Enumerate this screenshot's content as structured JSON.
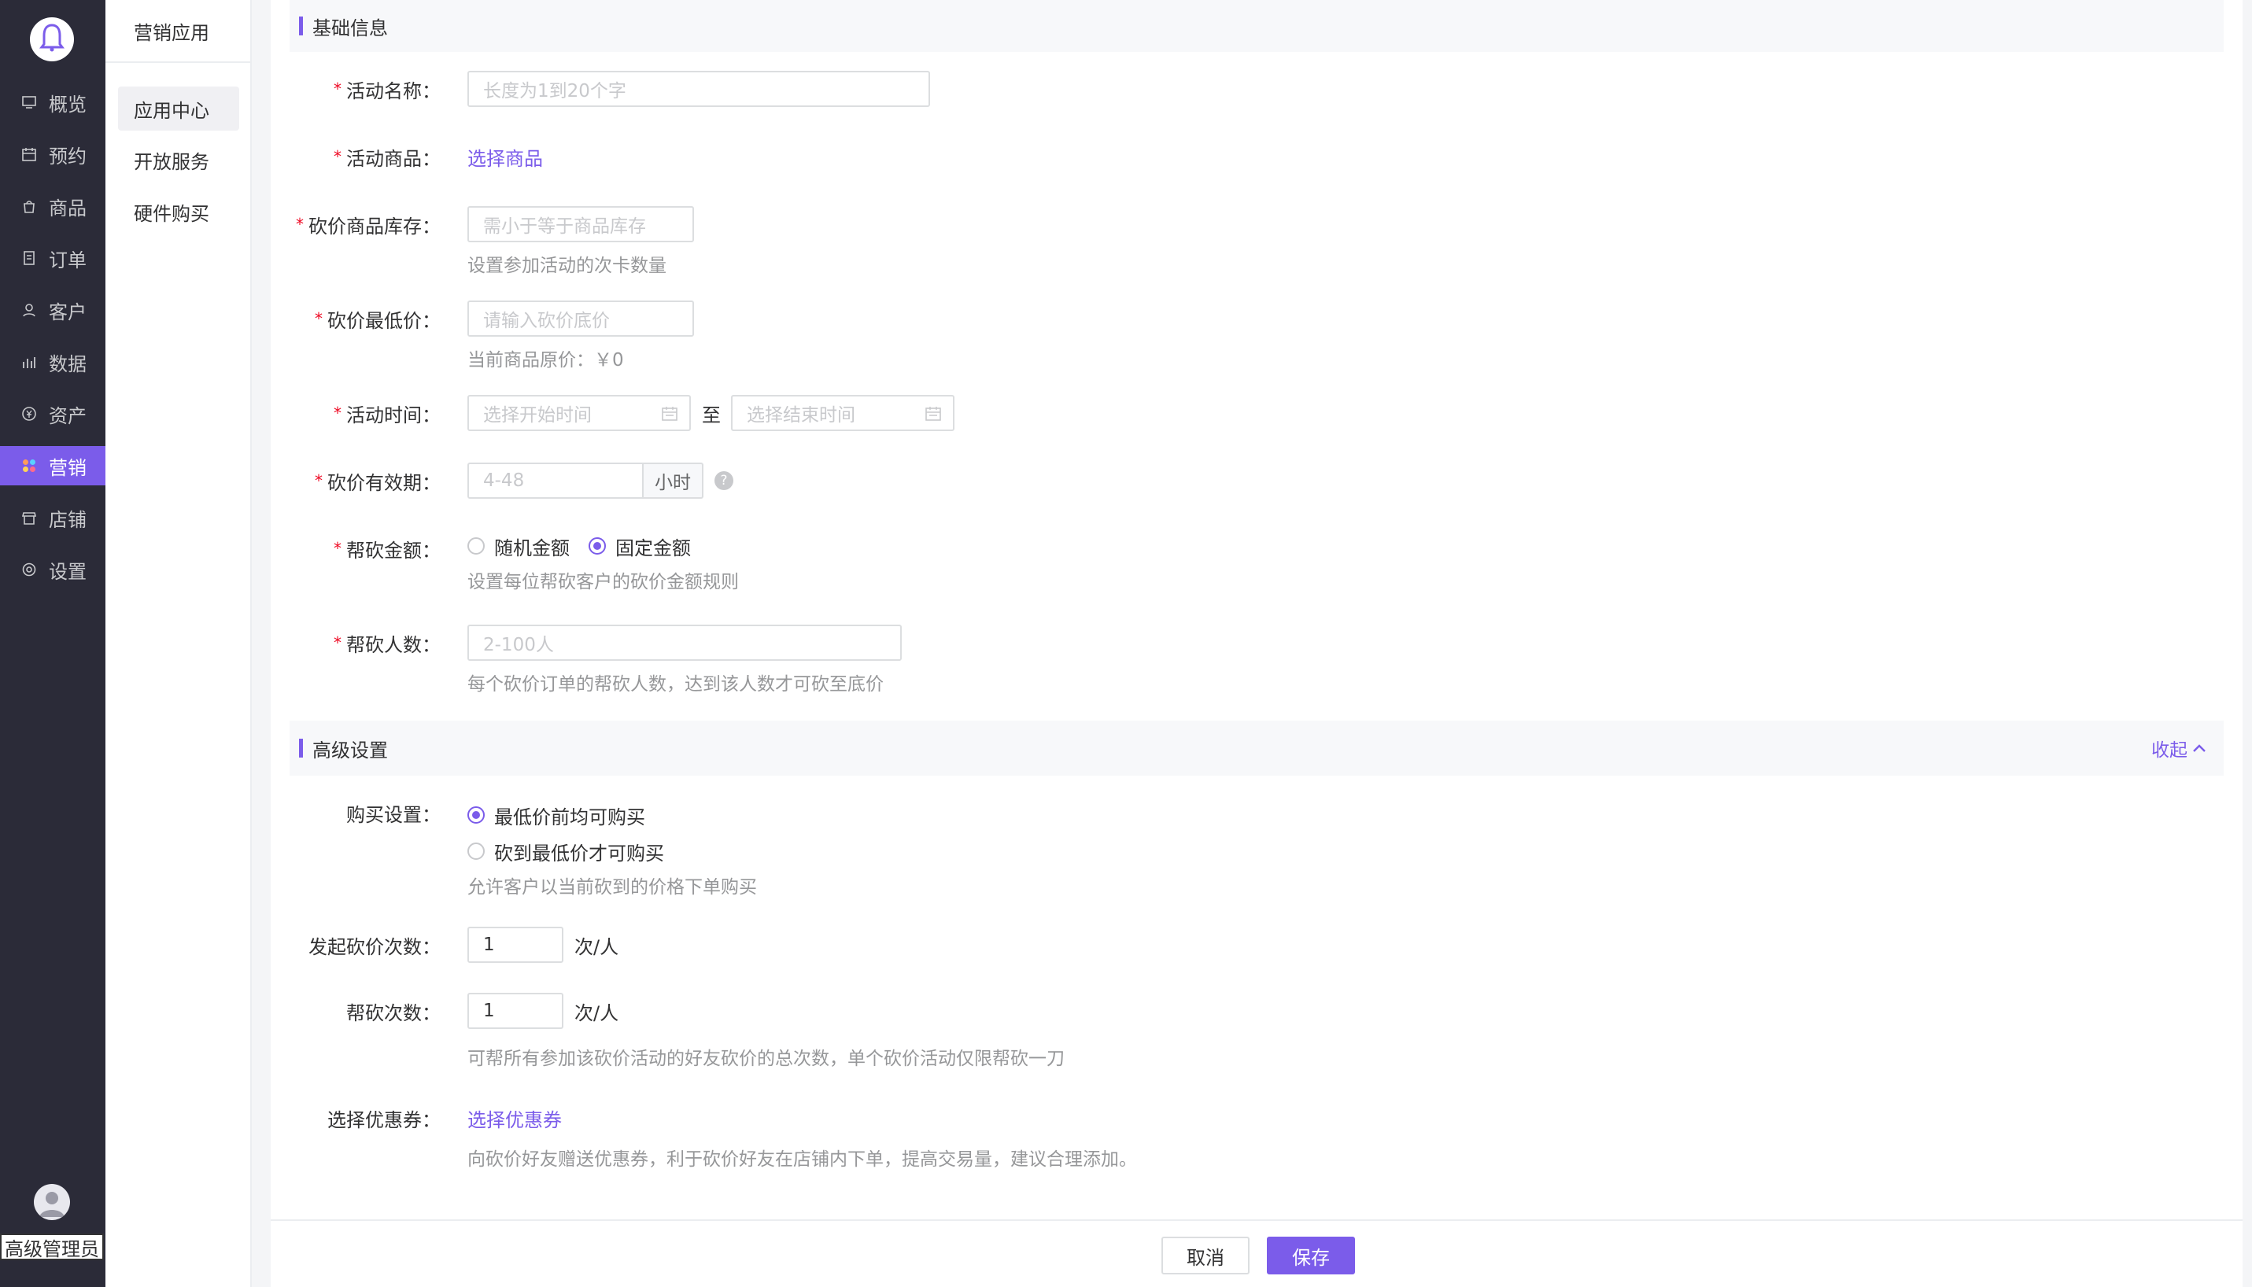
{
  "nav": {
    "items": [
      {
        "label": "概览",
        "icon": "overview-icon"
      },
      {
        "label": "预约",
        "icon": "appointment-icon"
      },
      {
        "label": "商品",
        "icon": "goods-icon"
      },
      {
        "label": "订单",
        "icon": "order-icon"
      },
      {
        "label": "客户",
        "icon": "customer-icon"
      },
      {
        "label": "数据",
        "icon": "data-icon"
      },
      {
        "label": "资产",
        "icon": "assets-icon"
      },
      {
        "label": "营销",
        "icon": "marketing-icon",
        "active": true
      },
      {
        "label": "店铺",
        "icon": "store-icon"
      },
      {
        "label": "设置",
        "icon": "settings-icon"
      }
    ],
    "user_label": "高级管理员"
  },
  "subnav": {
    "title": "营销应用",
    "items": [
      {
        "label": "应用中心",
        "active": true
      },
      {
        "label": "开放服务"
      },
      {
        "label": "硬件购买"
      }
    ]
  },
  "basic": {
    "section_title": "基础信息",
    "activity_name": {
      "label": "活动名称：",
      "placeholder": "长度为1到20个字"
    },
    "activity_goods": {
      "label": "活动商品：",
      "link": "选择商品"
    },
    "stock": {
      "label": "砍价商品库存：",
      "placeholder": "需小于等于商品库存",
      "help": "设置参加活动的次卡数量"
    },
    "min_price": {
      "label": "砍价最低价：",
      "placeholder": "请输入砍价底价",
      "help": "当前商品原价：￥0"
    },
    "activity_time": {
      "label": "活动时间：",
      "start_placeholder": "选择开始时间",
      "separator": "至",
      "end_placeholder": "选择结束时间"
    },
    "validity": {
      "label": "砍价有效期：",
      "placeholder": "4-48",
      "suffix": "小时",
      "help_icon": "?"
    },
    "help_amount": {
      "label": "帮砍金额：",
      "options": [
        "随机金额",
        "固定金额"
      ],
      "selected": "固定金额",
      "help": "设置每位帮砍客户的砍价金额规则"
    },
    "helper_count": {
      "label": "帮砍人数：",
      "placeholder": "2-100人",
      "help": "每个砍价订单的帮砍人数，达到该人数才可砍至底价"
    }
  },
  "advanced": {
    "section_title": "高级设置",
    "collapse_label": "收起",
    "purchase": {
      "label": "购买设置：",
      "options": [
        "最低价前均可购买",
        "砍到最低价才可购买"
      ],
      "selected": "最低价前均可购买",
      "help": "允许客户以当前砍到的价格下单购买"
    },
    "initiate_times": {
      "label": "发起砍价次数：",
      "value": "1",
      "unit": "次/人"
    },
    "help_times": {
      "label": "帮砍次数：",
      "value": "1",
      "unit": "次/人",
      "help": "可帮所有参加该砍价活动的好友砍价的总次数，单个砍价活动仅限帮砍一刀"
    },
    "coupon": {
      "label": "选择优惠券：",
      "link": "选择优惠券",
      "help": "向砍价好友赠送优惠券，利于砍价好友在店铺内下单，提高交易量，建议合理添加。"
    }
  },
  "footer": {
    "cancel_label": "取消",
    "save_label": "保存"
  },
  "colors": {
    "accent": "#7b5cea",
    "nav_bg": "#2b2b38",
    "required": "#ee0a24"
  }
}
